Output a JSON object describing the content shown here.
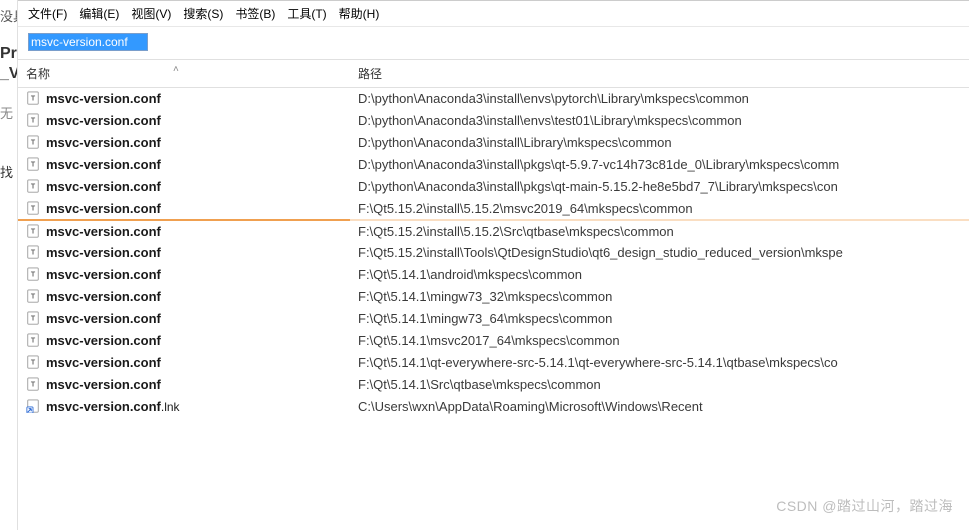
{
  "left_crop": [
    "没具",
    "Pr",
    "_V",
    "无",
    "找"
  ],
  "menu": {
    "file": "文件(F)",
    "edit": "编辑(E)",
    "view": "视图(V)",
    "search": "搜索(S)",
    "bookmark": "书签(B)",
    "tools": "工具(T)",
    "help": "帮助(H)"
  },
  "search": {
    "value": "msvc-version.conf"
  },
  "columns": {
    "name": "名称",
    "path": "路径"
  },
  "rows": [
    {
      "icon": "text",
      "name": "msvc-version.conf",
      "path": "D:\\python\\Anaconda3\\install\\envs\\pytorch\\Library\\mkspecs\\common",
      "hl": false
    },
    {
      "icon": "text",
      "name": "msvc-version.conf",
      "path": "D:\\python\\Anaconda3\\install\\envs\\test01\\Library\\mkspecs\\common",
      "hl": false
    },
    {
      "icon": "text",
      "name": "msvc-version.conf",
      "path": "D:\\python\\Anaconda3\\install\\Library\\mkspecs\\common",
      "hl": false
    },
    {
      "icon": "text",
      "name": "msvc-version.conf",
      "path": "D:\\python\\Anaconda3\\install\\pkgs\\qt-5.9.7-vc14h73c81de_0\\Library\\mkspecs\\comm",
      "hl": false
    },
    {
      "icon": "text",
      "name": "msvc-version.conf",
      "path": "D:\\python\\Anaconda3\\install\\pkgs\\qt-main-5.15.2-he8e5bd7_7\\Library\\mkspecs\\con",
      "hl": false
    },
    {
      "icon": "text",
      "name": "msvc-version.conf",
      "path": "F:\\Qt5.15.2\\install\\5.15.2\\msvc2019_64\\mkspecs\\common",
      "hl": true
    },
    {
      "icon": "text",
      "name": "msvc-version.conf",
      "path": "F:\\Qt5.15.2\\install\\5.15.2\\Src\\qtbase\\mkspecs\\common",
      "hl": false
    },
    {
      "icon": "text",
      "name": "msvc-version.conf",
      "path": "F:\\Qt5.15.2\\install\\Tools\\QtDesignStudio\\qt6_design_studio_reduced_version\\mkspe",
      "hl": false
    },
    {
      "icon": "text",
      "name": "msvc-version.conf",
      "path": "F:\\Qt\\5.14.1\\android\\mkspecs\\common",
      "hl": false
    },
    {
      "icon": "text",
      "name": "msvc-version.conf",
      "path": "F:\\Qt\\5.14.1\\mingw73_32\\mkspecs\\common",
      "hl": false
    },
    {
      "icon": "text",
      "name": "msvc-version.conf",
      "path": "F:\\Qt\\5.14.1\\mingw73_64\\mkspecs\\common",
      "hl": false
    },
    {
      "icon": "text",
      "name": "msvc-version.conf",
      "path": "F:\\Qt\\5.14.1\\msvc2017_64\\mkspecs\\common",
      "hl": false
    },
    {
      "icon": "text",
      "name": "msvc-version.conf",
      "path": "F:\\Qt\\5.14.1\\qt-everywhere-src-5.14.1\\qt-everywhere-src-5.14.1\\qtbase\\mkspecs\\co",
      "hl": false
    },
    {
      "icon": "text",
      "name": "msvc-version.conf",
      "path": "F:\\Qt\\5.14.1\\Src\\qtbase\\mkspecs\\common",
      "hl": false
    },
    {
      "icon": "lnk",
      "name": "msvc-version.conf",
      "ext": ".lnk",
      "path": "C:\\Users\\wxn\\AppData\\Roaming\\Microsoft\\Windows\\Recent",
      "hl": false
    }
  ],
  "watermark": "CSDN @踏过山河，踏过海"
}
